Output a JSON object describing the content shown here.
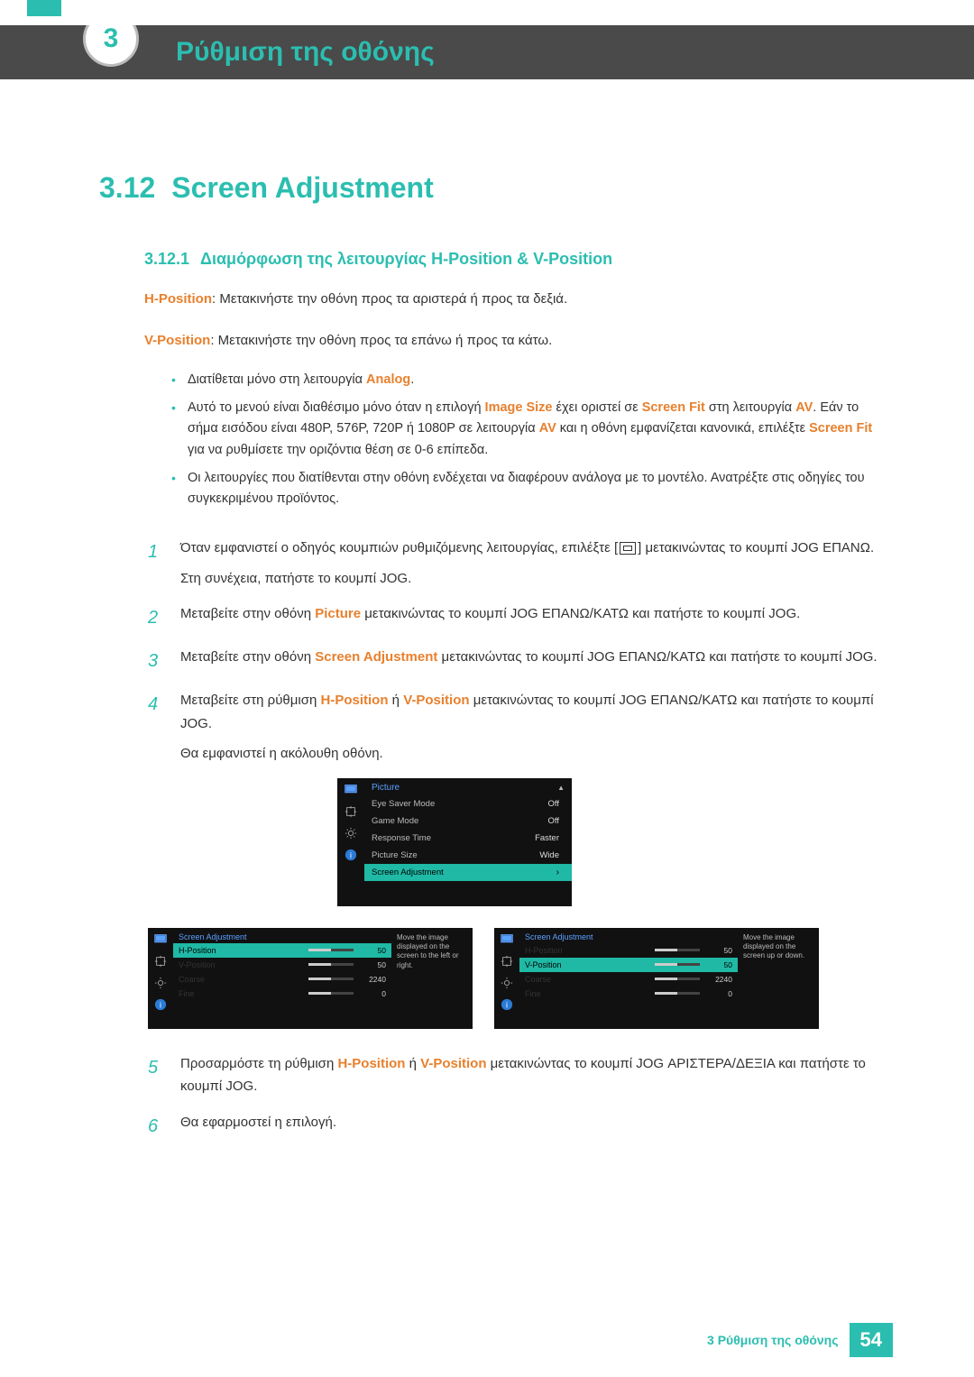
{
  "header": {
    "chapter_number": "3",
    "chapter_title": "Ρύθμιση της οθόνης"
  },
  "section": {
    "number": "3.12",
    "title": "Screen Adjustment"
  },
  "subsection": {
    "number": "3.12.1",
    "title": "Διαμόρφωση της λειτουργίας H-Position & V-Position"
  },
  "hpos": {
    "label": "H-Position",
    "desc": ": Μετακινήστε την οθόνη προς τα αριστερά ή προς τα δεξιά."
  },
  "vpos": {
    "label": "V-Position",
    "desc": ": Μετακινήστε την οθόνη προς τα επάνω ή προς τα κάτω."
  },
  "notes": {
    "n1_a": "Διατίθεται μόνο στη λειτουργία ",
    "n1_b": "Analog",
    "n1_c": ".",
    "n2_a": "Αυτό το μενού είναι διαθέσιμο μόνο όταν η επιλογή ",
    "n2_b": "Image Size",
    "n2_c": " έχει οριστεί σε ",
    "n2_d": "Screen Fit",
    "n2_e": " στη λειτουργία ",
    "n2_f": "AV",
    "n2_g": ". Εάν το σήμα εισόδου είναι 480P, 576P, 720P ή 1080P σε λειτουργία ",
    "n2_h": "AV",
    "n2_i": " και η οθόνη εμφανίζεται κανονικά, επιλέξτε ",
    "n2_j": "Screen Fit",
    "n2_k": " για να ρυθμίσετε την οριζόντια θέση σε 0-6 επίπεδα.",
    "n3": "Οι λειτουργίες που διατίθενται στην οθόνη ενδέχεται να διαφέρουν ανάλογα με το μοντέλο. Ανατρέξτε στις οδηγίες του συγκεκριμένου προϊόντος."
  },
  "steps": {
    "s1_a": "Όταν εμφανιστεί ο οδηγός κουμπιών ρυθμιζόμενης λειτουργίας, επιλέξτε [",
    "s1_b": "] μετακινώντας το κουμπί JOG ΕΠΑΝΩ.",
    "s1_c": "Στη συνέχεια, πατήστε το κουμπί JOG.",
    "s2_a": "Μεταβείτε στην οθόνη ",
    "s2_b": "Picture",
    "s2_c": " μετακινώντας το κουμπί JOG ΕΠΑΝΩ/ΚΑΤΩ και πατήστε το κουμπί JOG.",
    "s3_a": "Μεταβείτε στην οθόνη ",
    "s3_b": "Screen Adjustment",
    "s3_c": " μετακινώντας το κουμπί JOG ΕΠΑΝΩ/ΚΑΤΩ και πατήστε το κουμπί JOG.",
    "s4_a": "Μεταβείτε στη ρύθμιση ",
    "s4_b": "H-Position",
    "s4_c": " ή ",
    "s4_d": "V-Position",
    "s4_e": " μετακινώντας το κουμπί JOG ΕΠΑΝΩ/ΚΑΤΩ και πατήστε το κουμπί JOG.",
    "s4_f": "Θα εμφανιστεί η ακόλουθη οθόνη.",
    "s5_a": "Προσαρμόστε τη ρύθμιση ",
    "s5_b": "H-Position",
    "s5_c": " ή ",
    "s5_d": "V-Position",
    "s5_e": " μετακινώντας το κουμπί JOG ΑΡΙΣΤΕΡΑ/ΔΕΞΙΑ και πατήστε το κουμπί JOG.",
    "s6": "Θα εφαρμοστεί η επιλογή.",
    "nums": {
      "n1": "1",
      "n2": "2",
      "n3": "3",
      "n4": "4",
      "n5": "5",
      "n6": "6"
    }
  },
  "osd_picture": {
    "title": "Picture",
    "rows": [
      {
        "label": "Eye Saver Mode",
        "value": "Off"
      },
      {
        "label": "Game Mode",
        "value": "Off"
      },
      {
        "label": "Response Time",
        "value": "Faster"
      },
      {
        "label": "Picture Size",
        "value": "Wide"
      }
    ],
    "selected": {
      "label": "Screen Adjustment",
      "chev": "›"
    }
  },
  "osd_left": {
    "title": "Screen Adjustment",
    "rows": [
      {
        "label": "H-Position",
        "value": "50",
        "sel": true
      },
      {
        "label": "V-Position",
        "value": "50"
      },
      {
        "label": "Coarse",
        "value": "2240"
      },
      {
        "label": "Fine",
        "value": "0"
      }
    ],
    "desc": "Move the image displayed on the screen to the left or right."
  },
  "osd_right": {
    "title": "Screen Adjustment",
    "rows": [
      {
        "label": "H-Position",
        "value": "50"
      },
      {
        "label": "V-Position",
        "value": "50",
        "sel": true
      },
      {
        "label": "Coarse",
        "value": "2240"
      },
      {
        "label": "Fine",
        "value": "0"
      }
    ],
    "desc": "Move the image displayed on the screen up or down."
  },
  "footer": {
    "text": "3 Ρύθμιση της οθόνης",
    "page": "54"
  }
}
